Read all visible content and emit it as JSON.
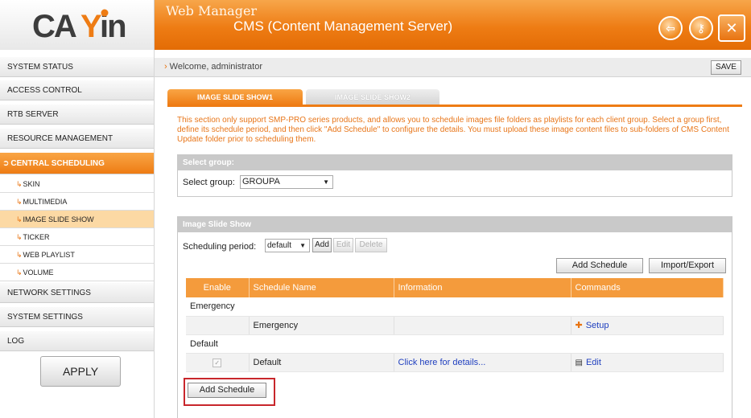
{
  "header": {
    "logo_text": "CAYIN",
    "title_line1": "Web Manager",
    "title_line2": "CMS (Content Management Server)",
    "icons": [
      "logout-icon",
      "key-icon",
      "tools-icon"
    ],
    "brand_color": "#ee7c14"
  },
  "sidebar": {
    "items": [
      {
        "label": "SYSTEM STATUS"
      },
      {
        "label": "ACCESS CONTROL"
      },
      {
        "label": "RTB SERVER"
      },
      {
        "label": "RESOURCE MANAGEMENT"
      },
      {
        "label": "CENTRAL SCHEDULING",
        "active": true
      }
    ],
    "subitems": [
      {
        "label": "SKIN"
      },
      {
        "label": "MULTIMEDIA"
      },
      {
        "label": "IMAGE SLIDE SHOW",
        "selected": true
      },
      {
        "label": "TICKER"
      },
      {
        "label": "WEB PLAYLIST"
      },
      {
        "label": "VOLUME"
      }
    ],
    "bottom_items": [
      {
        "label": "NETWORK SETTINGS"
      },
      {
        "label": "SYSTEM SETTINGS"
      },
      {
        "label": "LOG"
      }
    ],
    "apply_label": "APPLY"
  },
  "topbar": {
    "welcome": "Welcome, administrator",
    "save_label": "SAVE"
  },
  "tabs": [
    {
      "label": "IMAGE SLIDE SHOW1",
      "active": true
    },
    {
      "label": "IMAGE SLIDE SHOW2",
      "active": false
    }
  ],
  "description": "This section only support SMP-PRO series products, and allows you to schedule images file folders as playlists for each client group. Select a group first, define its schedule period, and then click \"Add Schedule\" to configure the details. You must upload these image content files to sub-folders of CMS Content Update folder prior to scheduling them.",
  "group_panel": {
    "heading": "Select group:",
    "label": "Select group:",
    "selected": "GROUPA"
  },
  "show_panel": {
    "heading": "Image Slide Show",
    "period_label": "Scheduling period:",
    "period_selected": "default",
    "add_label": "Add",
    "edit_label": "Edit",
    "delete_label": "Delete",
    "add_schedule_label": "Add Schedule",
    "import_export_label": "Import/Export"
  },
  "table": {
    "headers": [
      "Enable",
      "Schedule Name",
      "Information",
      "Commands"
    ],
    "groups": [
      {
        "name": "Emergency",
        "rows": [
          {
            "enable": "",
            "name": "Emergency",
            "information": "",
            "command": "Setup"
          }
        ]
      },
      {
        "name": "Default",
        "rows": [
          {
            "enable": "checked",
            "name": "Default",
            "information": "Click here for details...",
            "command": "Edit"
          }
        ]
      }
    ]
  },
  "bottom_add_schedule_label": "Add Schedule",
  "highlight_color": "#c8262b"
}
